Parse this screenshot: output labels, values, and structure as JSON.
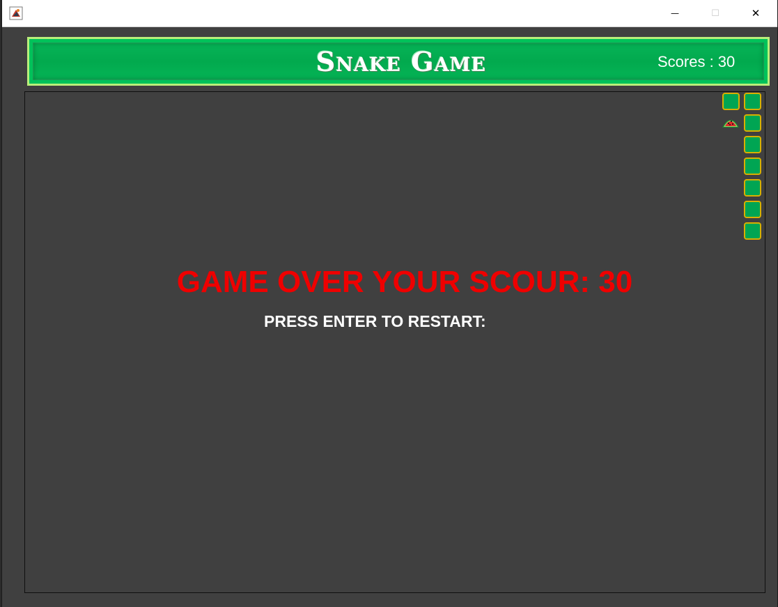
{
  "window": {
    "title": "",
    "icon": "java-app-icon",
    "controls": {
      "minimize": "—",
      "maximize": "☐",
      "close": "✕"
    }
  },
  "header": {
    "title": "Snake Game",
    "score_label": "Scores : 30"
  },
  "game": {
    "state": "game-over",
    "score": 30,
    "snake_length": 8,
    "fruit": "watermelon-icon",
    "game_over_text": "GAME OVER YOUR SCOUR: 30",
    "restart_text": "PRESS ENTER TO RESTART:"
  },
  "colors": {
    "board_bg": "#404040",
    "header_green": "#00b050",
    "header_border": "#b9ef7a",
    "snake_fill": "#00a553",
    "snake_border": "#d9b000",
    "game_over_text": "#ef0000"
  }
}
